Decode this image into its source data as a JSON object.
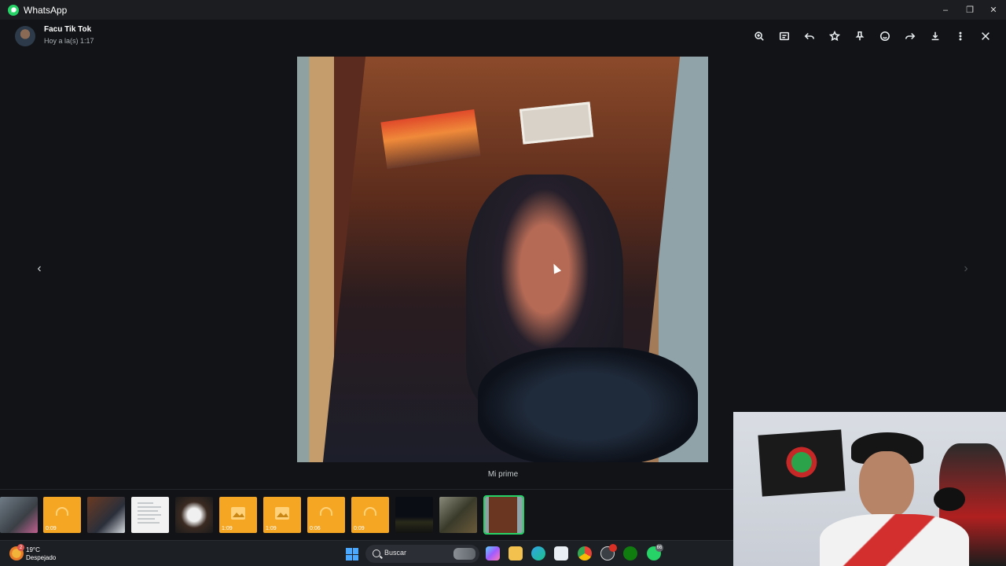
{
  "window": {
    "title": "WhatsApp",
    "controls": [
      "minimize",
      "restore",
      "close"
    ]
  },
  "viewer": {
    "contact_name": "Facu Tik Tok",
    "timestamp": "Hoy a la(s) 1:17",
    "caption": "Mi prime",
    "toolbar": [
      "zoom-in-icon",
      "caption-icon",
      "reply-icon",
      "star-icon",
      "pin-icon",
      "emoji-icon",
      "forward-icon",
      "download-icon",
      "more-icon",
      "close-icon"
    ]
  },
  "thumbnails": [
    {
      "kind": "photo",
      "label": ""
    },
    {
      "kind": "audio",
      "label": "0:09"
    },
    {
      "kind": "photo",
      "label": ""
    },
    {
      "kind": "document",
      "label": ""
    },
    {
      "kind": "photo",
      "label": ""
    },
    {
      "kind": "image-audio",
      "label": "1:09"
    },
    {
      "kind": "image-audio",
      "label": "1:09"
    },
    {
      "kind": "audio",
      "label": "0:06"
    },
    {
      "kind": "audio",
      "label": "0:09"
    },
    {
      "kind": "photo",
      "label": ""
    },
    {
      "kind": "photo",
      "label": ""
    },
    {
      "kind": "photo",
      "label": "",
      "selected": true
    }
  ],
  "taskbar": {
    "weather_temp": "19°C",
    "weather_desc": "Despejado",
    "weather_badge": "2",
    "search_placeholder": "Buscar",
    "whatsapp_badge": "66"
  },
  "colors": {
    "accent": "#25d366",
    "audio_thumb": "#f5a623",
    "background": "#111316"
  }
}
